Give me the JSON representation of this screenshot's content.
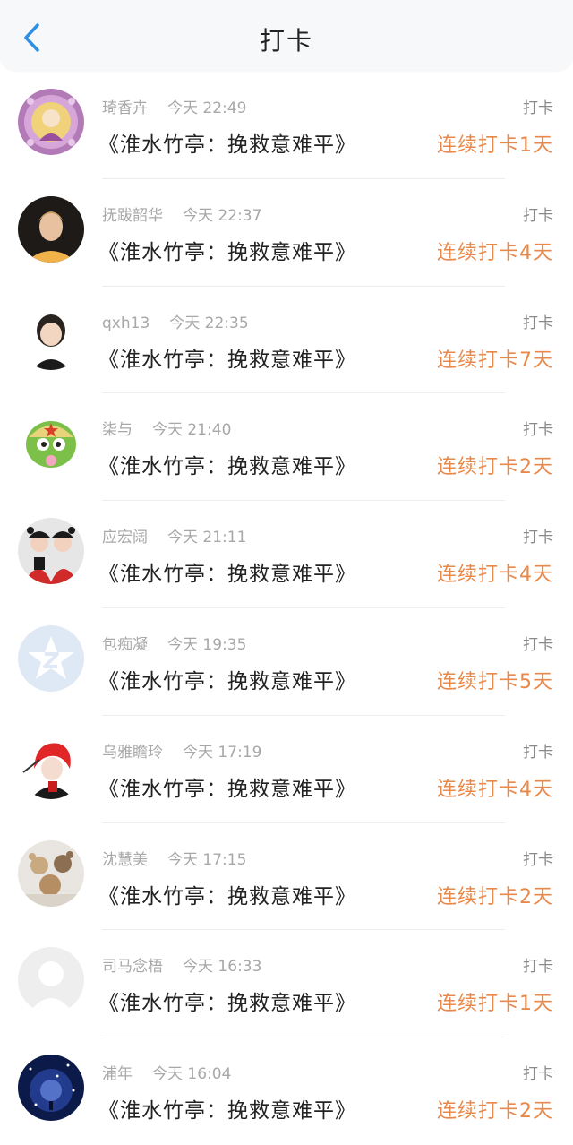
{
  "header": {
    "title": "打卡"
  },
  "accent_color": "#e8884a",
  "rows": [
    {
      "name": "琦香卉",
      "time": "今天 22:49",
      "content": "《淮水竹亭：挽救意难平》",
      "action": "打卡",
      "streak": "连续打卡1天",
      "avatar_icon": "ornate-portrait-avatar"
    },
    {
      "name": "抚跋韶华",
      "time": "今天 22:37",
      "content": "《淮水竹亭：挽救意难平》",
      "action": "打卡",
      "streak": "连续打卡4天",
      "avatar_icon": "person-photo-avatar"
    },
    {
      "name": "qxh13",
      "time": "今天 22:35",
      "content": "《淮水竹亭：挽救意难平》",
      "action": "打卡",
      "streak": "连续打卡7天",
      "avatar_icon": "cartoon-person-avatar"
    },
    {
      "name": "柒与",
      "time": "今天 21:40",
      "content": "《淮水竹亭：挽救意难平》",
      "action": "打卡",
      "streak": "连续打卡2天",
      "avatar_icon": "green-frog-avatar"
    },
    {
      "name": "应宏阔",
      "time": "今天 21:11",
      "content": "《淮水竹亭：挽救意难平》",
      "action": "打卡",
      "streak": "连续打卡4天",
      "avatar_icon": "two-girls-avatar"
    },
    {
      "name": "包痴凝",
      "time": "今天 19:35",
      "content": "《淮水竹亭：挽救意难平》",
      "action": "打卡",
      "streak": "连续打卡5天",
      "avatar_icon": "default-star-avatar"
    },
    {
      "name": "乌雅瞻玲",
      "time": "今天 17:19",
      "content": "《淮水竹亭：挽救意难平》",
      "action": "打卡",
      "streak": "连续打卡4天",
      "avatar_icon": "red-hair-anime-avatar"
    },
    {
      "name": "沈慧美",
      "time": "今天 17:15",
      "content": "《淮水竹亭：挽救意难平》",
      "action": "打卡",
      "streak": "连续打卡2天",
      "avatar_icon": "teddy-bears-avatar"
    },
    {
      "name": "司马念梧",
      "time": "今天 16:33",
      "content": "《淮水竹亭：挽救意难平》",
      "action": "打卡",
      "streak": "连续打卡1天",
      "avatar_icon": "default-user-avatar"
    },
    {
      "name": "浦年",
      "time": "今天 16:04",
      "content": "《淮水竹亭：挽救意难平》",
      "action": "打卡",
      "streak": "连续打卡2天",
      "avatar_icon": "galaxy-avatar"
    }
  ]
}
